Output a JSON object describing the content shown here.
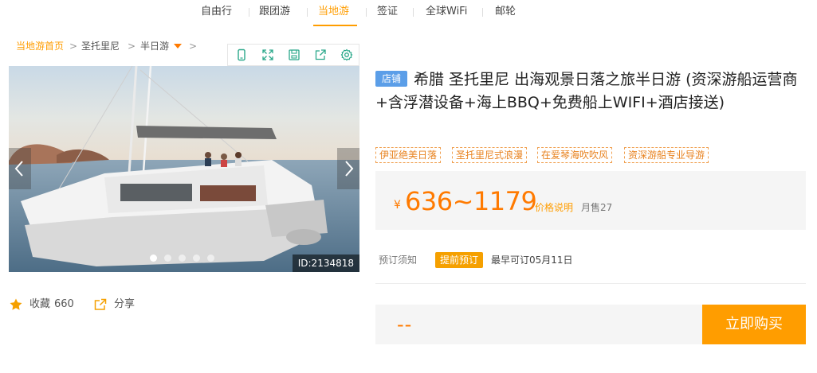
{
  "nav": {
    "items": [
      {
        "label": "自由行"
      },
      {
        "label": "跟团游"
      },
      {
        "label": "当地游",
        "active": true
      },
      {
        "label": "签证"
      },
      {
        "label": "全球WiFi"
      },
      {
        "label": "邮轮"
      }
    ]
  },
  "breadcrumb": {
    "home": "当地游首页",
    "city": "圣托里尼",
    "category": "半日游",
    "separator": ">"
  },
  "toolbar": {
    "icons": [
      "mobile-icon",
      "fullscreen-icon",
      "save-icon",
      "share-out-icon",
      "settings-icon"
    ]
  },
  "gallery": {
    "image_id": "ID:2134818",
    "slide_count": 5,
    "active_slide": 1,
    "image_description": "white catamaran sailing on calm sea at sunset"
  },
  "actions": {
    "favorite_label": "收藏",
    "favorite_count": "660",
    "share_label": "分享"
  },
  "product": {
    "shop_badge": "店铺",
    "title": "希腊 圣托里尼 出海观景日落之旅半日游 (资深游船运营商+含浮潜设备+海上BBQ+免费船上WIFI+酒店接送)",
    "tags": [
      "伊亚绝美日落",
      "圣托里尼式浪漫",
      "在爱琴海吹吹风",
      "资深游船专业导游"
    ]
  },
  "price": {
    "currency": "¥",
    "range": "636~1179",
    "note": "价格说明",
    "sold": "月售27"
  },
  "booking": {
    "label": "预订须知",
    "pill": "提前预订",
    "earliest": "最早可订05月11日"
  },
  "purchase": {
    "quantity_placeholder": "--",
    "buy_label": "立即购买"
  },
  "colors": {
    "accent": "#ff9d00",
    "price": "#ff7a00",
    "shop_badge": "#5b9ee8",
    "panel_bg": "#f5f5f5"
  }
}
